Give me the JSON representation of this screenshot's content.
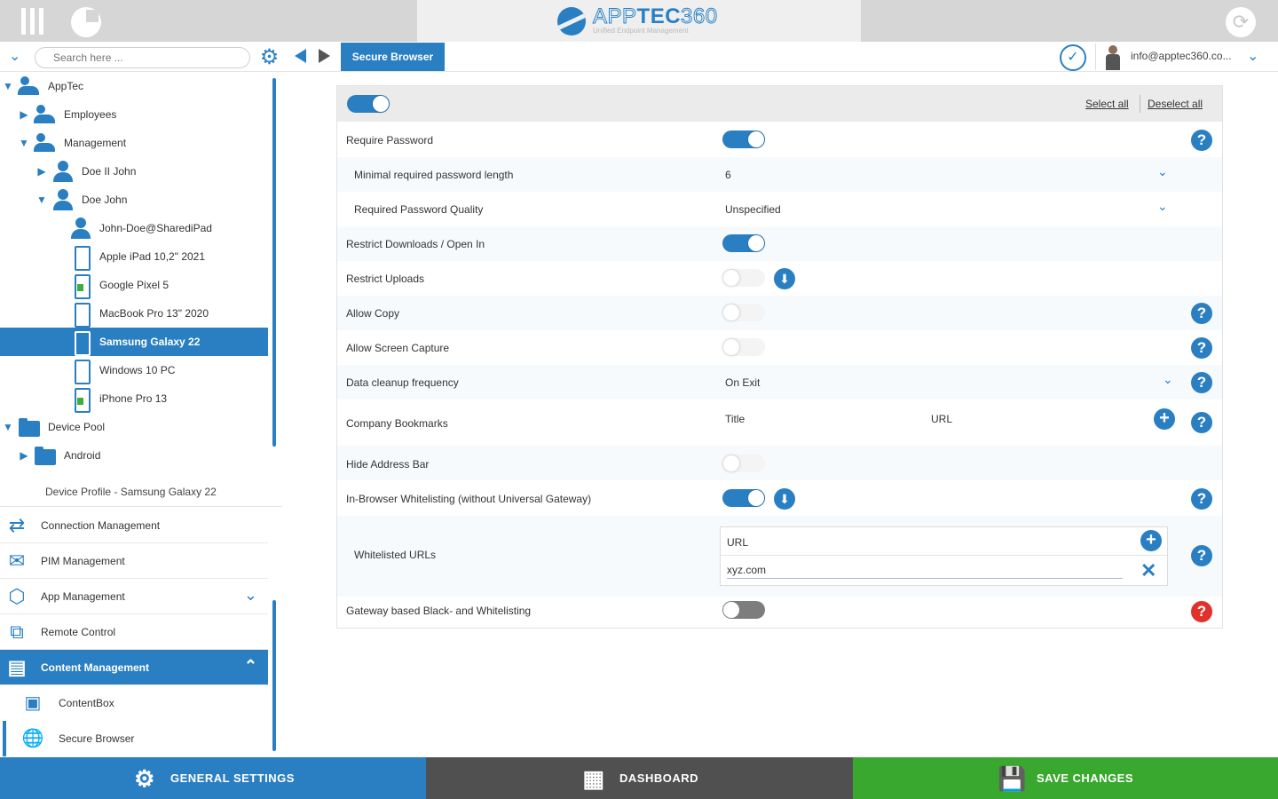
{
  "app": {
    "logo_part1": "APP",
    "logo_part2": "TEC",
    "logo_part3": "360",
    "logo_subtitle": "Unified Endpoint Management"
  },
  "toolbar": {
    "search_placeholder": "Search here ...",
    "active_tab": "Secure Browser",
    "user_email": "info@apptec360.co..."
  },
  "tree": {
    "items": [
      {
        "label": "AppTec"
      },
      {
        "label": "Employees"
      },
      {
        "label": "Management"
      },
      {
        "label": "Doe II John"
      },
      {
        "label": "Doe John"
      },
      {
        "label": "John-Doe@SharediPad"
      },
      {
        "label": "Apple iPad 10,2\" 2021"
      },
      {
        "label": "Google Pixel 5"
      },
      {
        "label": "MacBook Pro 13\" 2020"
      },
      {
        "label": "Samsung Galaxy 22"
      },
      {
        "label": "Windows 10 PC"
      },
      {
        "label": "iPhone Pro 13"
      },
      {
        "label": "Device Pool"
      },
      {
        "label": "Android"
      }
    ],
    "profile_label": "Device Profile - Samsung Galaxy 22"
  },
  "menu": {
    "connection": "Connection Management",
    "pim": "PIM Management",
    "app": "App Management",
    "remote": "Remote Control",
    "content": "Content Management",
    "contentbox": "ContentBox",
    "secure_browser": "Secure Browser"
  },
  "panel": {
    "select_all": "Select all",
    "deselect_all": "Deselect all",
    "rows": {
      "require_password": "Require Password",
      "min_pw_length": "Minimal required password length",
      "min_pw_length_value": "6",
      "pw_quality": "Required Password Quality",
      "pw_quality_value": "Unspecified",
      "restrict_downloads": "Restrict Downloads / Open In",
      "restrict_uploads": "Restrict Uploads",
      "allow_copy": "Allow Copy",
      "allow_screen_capture": "Allow Screen Capture",
      "data_cleanup": "Data cleanup frequency",
      "data_cleanup_value": "On Exit",
      "company_bookmarks": "Company Bookmarks",
      "bookmarks_title_col": "Title",
      "bookmarks_url_col": "URL",
      "hide_address_bar": "Hide Address Bar",
      "in_browser_whitelisting": "In-Browser Whitelisting (without Universal Gateway)",
      "whitelisted_urls": "Whitelisted URLs",
      "url_col": "URL",
      "url_value": "xyz.com",
      "gateway_whitelisting": "Gateway based Black- and Whitelisting"
    }
  },
  "footer": {
    "general_settings": "GENERAL SETTINGS",
    "dashboard": "DASHBOARD",
    "save_changes": "SAVE CHANGES"
  },
  "colors": {
    "accent": "#2a7fc3",
    "save_green": "#38a92e",
    "dashboard_grey": "#505050",
    "help_red": "#e0312b"
  }
}
